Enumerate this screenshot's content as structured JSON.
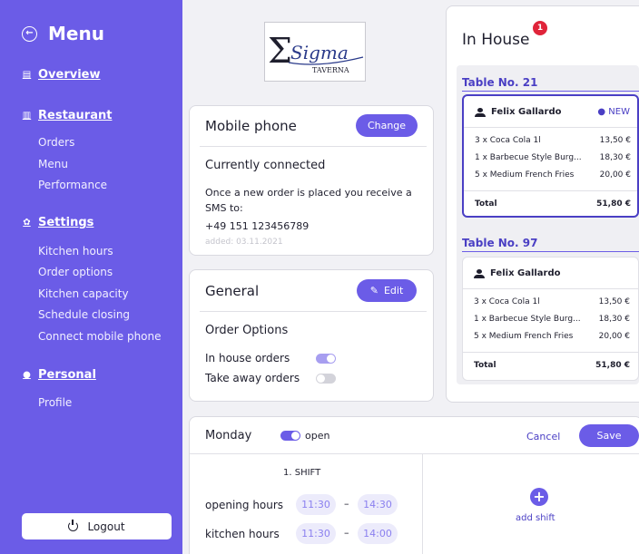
{
  "sidebar": {
    "title": "Menu",
    "sections": [
      {
        "label": "Overview",
        "items": []
      },
      {
        "label": "Restaurant",
        "items": [
          "Orders",
          "Menu",
          "Performance"
        ]
      },
      {
        "label": "Settings",
        "items": [
          "Kitchen hours",
          "Order options",
          "Kitchen capacity",
          "Schedule closing",
          "Connect mobile phone"
        ]
      },
      {
        "label": "Personal",
        "items": [
          "Profile"
        ]
      }
    ],
    "logout_label": "Logout"
  },
  "logo": {
    "brand_text": "Sigma",
    "sub_text": "TAVERNA"
  },
  "mobile_phone": {
    "title": "Mobile phone",
    "change_label": "Change",
    "status_heading": "Currently connected",
    "description": "Once a new order is placed you receive a SMS to:",
    "phone_number": "+49 151 123456789",
    "added": "added: 03.11.2021"
  },
  "general": {
    "title": "General",
    "edit_label": "Edit",
    "options_heading": "Order Options",
    "options": [
      {
        "label": "In house orders",
        "enabled": true
      },
      {
        "label": "Take away orders",
        "enabled": false
      }
    ]
  },
  "in_house": {
    "title": "In House",
    "badge_count": "1",
    "tables": [
      {
        "heading": "Table No. 21",
        "customer": "Felix Gallardo",
        "badge": "● NEW",
        "items": [
          {
            "name": "3 x Coca Cola 1l",
            "price": "13,50 €"
          },
          {
            "name": "1 x Barbecue Style Burg...",
            "price": "18,30 €"
          },
          {
            "name": "5 x Medium French Fries",
            "price": "20,00 €"
          }
        ],
        "total_label": "Total",
        "total": "51,80 €"
      },
      {
        "heading": "Table No. 97",
        "customer": "Felix Gallardo",
        "badge": "",
        "items": [
          {
            "name": "3 x Coca Cola 1l",
            "price": "13,50 €"
          },
          {
            "name": "1 x Barbecue Style Burg...",
            "price": "18,30 €"
          },
          {
            "name": "5 x Medium French Fries",
            "price": "20,00 €"
          }
        ],
        "total_label": "Total",
        "total": "51,80 €"
      }
    ]
  },
  "schedule": {
    "day": "Monday",
    "status": "open",
    "open": true,
    "cancel_label": "Cancel",
    "save_label": "Save",
    "shift_title": "1. SHIFT",
    "opening_label": "opening hours",
    "opening_from": "11:30",
    "opening_to": "14:30",
    "kitchen_label": "kitchen hours",
    "kitchen_from": "11:30",
    "kitchen_to": "14:00",
    "separator": "–",
    "add_shift_label": "add shift"
  },
  "colors": {
    "accent": "#6b5ce7",
    "accent_dark": "#4a3fc4",
    "badge_red": "#e0243a"
  }
}
